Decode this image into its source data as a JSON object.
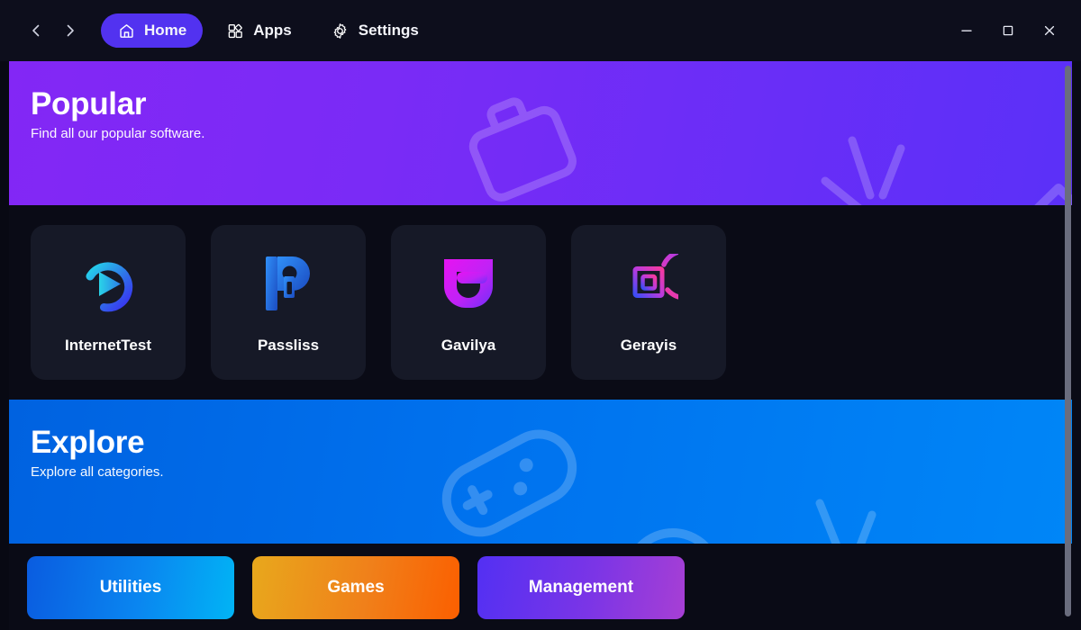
{
  "window": {
    "background_color": "#0a0b16",
    "titlebar_color": "#0d0e1c",
    "controls": [
      {
        "name": "minimize",
        "glyph": "minimize-icon"
      },
      {
        "name": "maximize",
        "glyph": "maximize-icon"
      },
      {
        "name": "close",
        "glyph": "close-icon"
      }
    ]
  },
  "nav": {
    "back_label": "chevron-left-icon",
    "forward_label": "chevron-right-icon",
    "tabs": [
      {
        "label": "Home",
        "icon": "home-icon",
        "active": true
      },
      {
        "label": "Apps",
        "icon": "apps-icon",
        "active": false
      },
      {
        "label": "Settings",
        "icon": "gear-icon",
        "active": false
      }
    ],
    "active_tab_color": "#5232f0"
  },
  "banners": [
    {
      "id": "popular",
      "title": "Popular",
      "subtitle": "Find all our popular software.",
      "gradient_from": "#8327f5",
      "gradient_to": "#5b30f8",
      "decorations": [
        "briefcase-icon",
        "mail-icon",
        "sparkle-lines-icon",
        "chevron-up-icon"
      ]
    },
    {
      "id": "explore",
      "title": "Explore",
      "subtitle": "Explore all categories.",
      "gradient_from": "#0062e0",
      "gradient_to": "#0086f7",
      "decorations": [
        "gamepad-icon",
        "circle-arc-icon",
        "sparkle-lines-icon"
      ]
    }
  ],
  "apps": [
    {
      "name": "InternetTest",
      "logo": "internettest-logo",
      "accent_from": "#2ad4e8",
      "accent_to": "#3a3df0"
    },
    {
      "name": "Passliss",
      "logo": "passliss-logo",
      "accent_from": "#1f5fd8",
      "accent_to": "#2f8bf5"
    },
    {
      "name": "Gavilya",
      "logo": "gavilya-logo",
      "accent_from": "#e818f0",
      "accent_to": "#7b2ff7"
    },
    {
      "name": "Gerayis",
      "logo": "gerayis-logo",
      "accent_from": "#f0389e",
      "accent_to": "#8b3af2"
    }
  ],
  "categories": [
    {
      "label": "Utilities",
      "gradient_from": "#0a5ce0",
      "gradient_to": "#01b4f5"
    },
    {
      "label": "Games",
      "gradient_from": "#e8a81c",
      "gradient_to": "#fb5f00"
    },
    {
      "label": "Management",
      "gradient_from": "#5330f3",
      "gradient_to": "#a73fd4"
    }
  ],
  "scrollbar": {
    "thumb_color": "#6a6d7e"
  }
}
